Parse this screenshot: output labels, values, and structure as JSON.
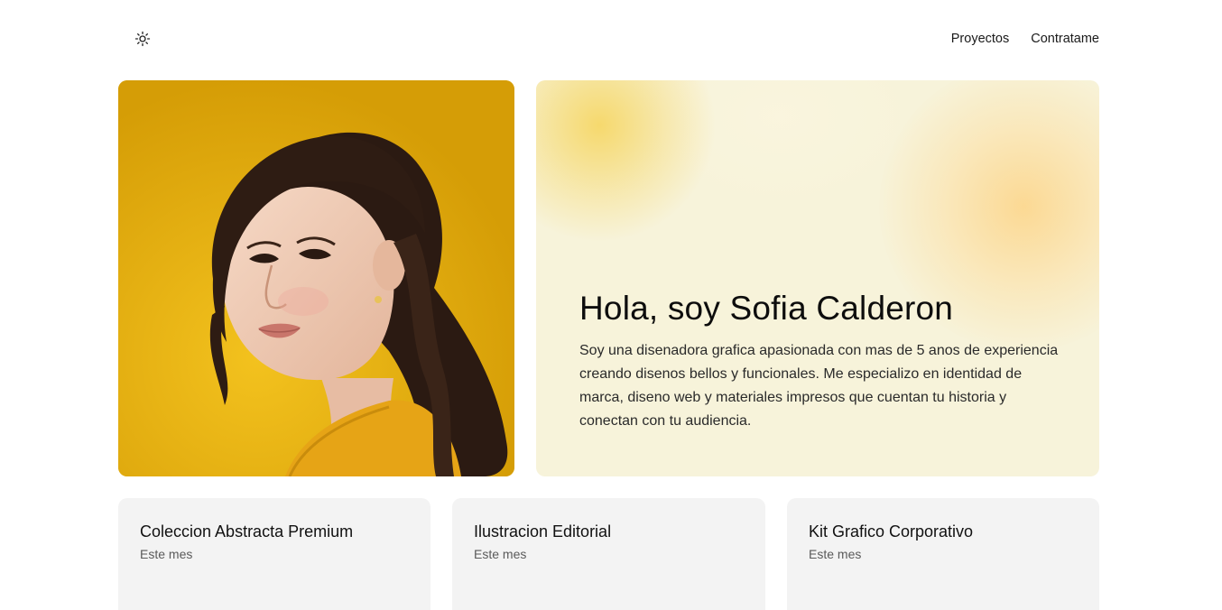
{
  "header": {
    "theme_icon": "sun-icon",
    "nav": [
      {
        "label": "Proyectos"
      },
      {
        "label": "Contratame"
      }
    ]
  },
  "hero": {
    "title": "Hola, soy Sofia Calderon",
    "description": "Soy una disenadora grafica apasionada con mas de 5 anos de experiencia creando disenos bellos y funcionales. Me especializo en identidad de marca, diseno web y materiales impresos que cuentan tu historia y conectan con tu audiencia.",
    "colors": {
      "portrait_bg": "#e9b413",
      "card_bg": "#f7f3da"
    }
  },
  "projects": [
    {
      "title": "Coleccion Abstracta Premium",
      "date": "Este mes"
    },
    {
      "title": "Ilustracion Editorial",
      "date": "Este mes"
    },
    {
      "title": "Kit Grafico Corporativo",
      "date": "Este mes"
    }
  ]
}
